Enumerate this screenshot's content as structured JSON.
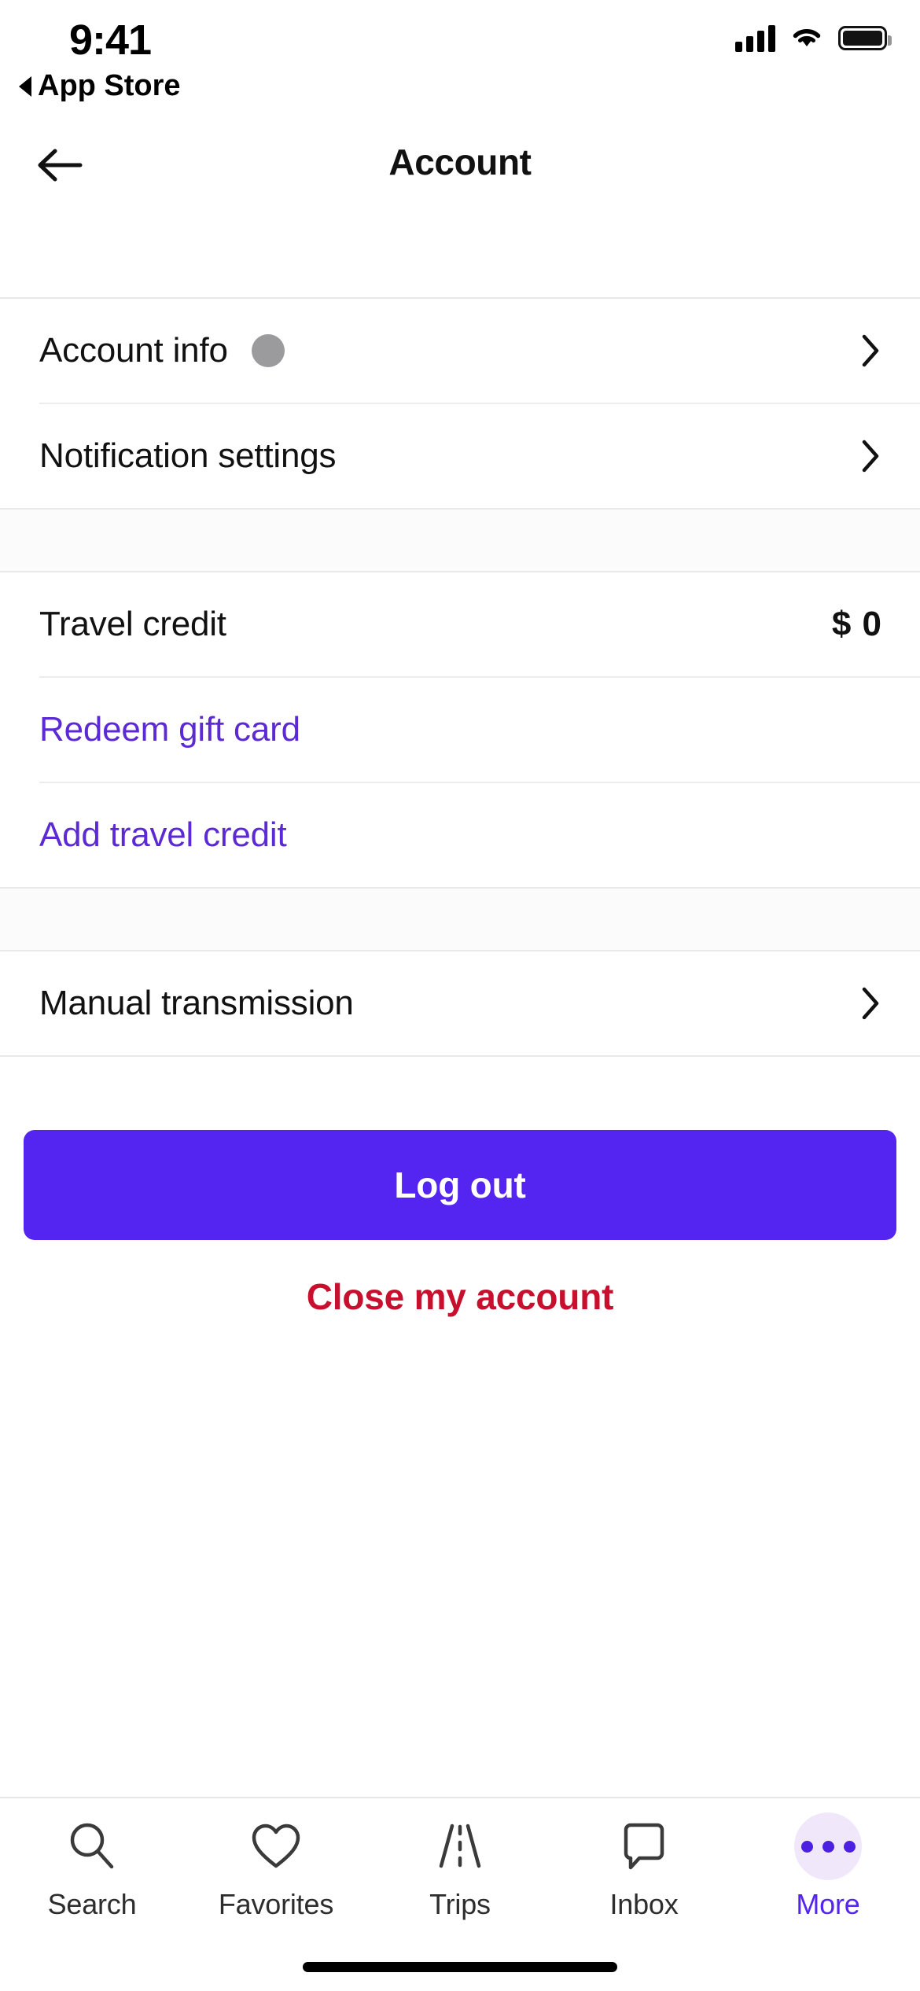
{
  "status_bar": {
    "time": "9:41",
    "back_to_app": "App Store",
    "cellular_icon": "signal-bars-icon",
    "wifi_icon": "wifi-icon",
    "battery_icon": "battery-full-icon"
  },
  "header": {
    "back_icon": "back-arrow-icon",
    "title": "Account"
  },
  "groups": [
    {
      "rows": [
        {
          "label": "Account info",
          "type": "chevron",
          "has_avatar": true,
          "accessory_icon": "chevron-right-icon"
        },
        {
          "label": "Notification settings",
          "type": "chevron",
          "has_avatar": false,
          "accessory_icon": "chevron-right-icon"
        }
      ]
    },
    {
      "rows": [
        {
          "label": "Travel credit",
          "type": "value",
          "value": "$ 0"
        },
        {
          "label": "Redeem gift card",
          "type": "link"
        },
        {
          "label": "Add travel credit",
          "type": "link"
        }
      ]
    },
    {
      "rows": [
        {
          "label": "Manual transmission",
          "type": "chevron",
          "has_avatar": false,
          "accessory_icon": "chevron-right-icon"
        }
      ]
    }
  ],
  "actions": {
    "logout_label": "Log out",
    "close_account_label": "Close my account"
  },
  "tab_bar": {
    "items": [
      {
        "label": "Search",
        "icon": "search-icon",
        "active": false
      },
      {
        "label": "Favorites",
        "icon": "heart-icon",
        "active": false
      },
      {
        "label": "Trips",
        "icon": "road-icon",
        "active": false
      },
      {
        "label": "Inbox",
        "icon": "message-icon",
        "active": false
      },
      {
        "label": "More",
        "icon": "more-dots-icon",
        "active": true
      }
    ]
  },
  "colors": {
    "accent_purple": "#5424f0",
    "link_purple": "#5c2ad4",
    "danger_red": "#c8102e",
    "more_bg": "#f0e7fb",
    "divider": "#e9e9e9"
  }
}
